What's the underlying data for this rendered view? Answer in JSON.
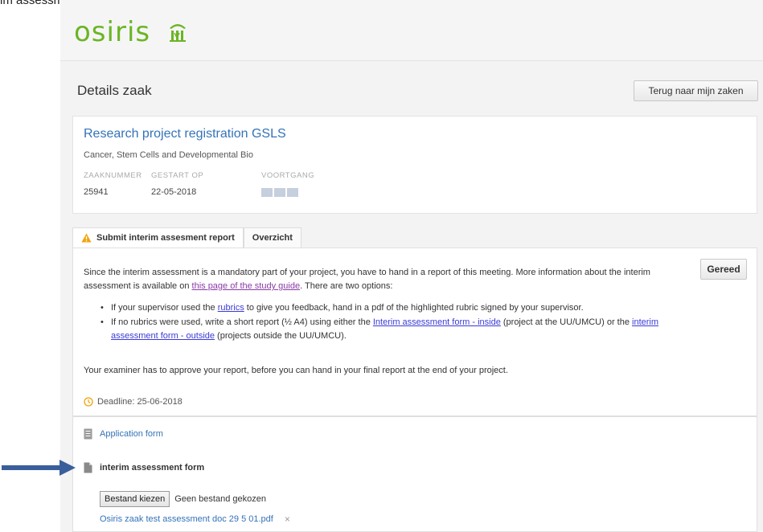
{
  "top_partial_text": "im assessment.",
  "logo": {
    "text": "osiris"
  },
  "page": {
    "title": "Details zaak",
    "back_button": "Terug naar mijn zaken"
  },
  "case": {
    "title": "Research project registration GSLS",
    "subtitle": "Cancer, Stem Cells and Developmental Bio",
    "meta": {
      "number_label": "ZAAKNUMMER",
      "number_value": "25941",
      "started_label": "GESTART OP",
      "started_value": "22-05-2018",
      "progress_label": "VOORTGANG",
      "progress_steps": 3
    }
  },
  "tabs": [
    {
      "label": "Submit interim assesment report",
      "active": true
    },
    {
      "label": "Overzicht",
      "active": false
    }
  ],
  "task": {
    "done_button": "Gereed",
    "intro_part1": "Since the interim assessment is a mandatory part of your project, you have to hand in a report of this meeting. More information about the interim assessment is available on ",
    "intro_link": "this page of the study guide",
    "intro_part2": ". There are two options:",
    "bullet1_part1": "If your supervisor used the ",
    "bullet1_link": "rubrics",
    "bullet1_part2": " to give you feedback, hand in a pdf of the highlighted rubric signed by your supervisor.",
    "bullet2_part1": "If no rubrics were used, write a short report (½ A4) using either the ",
    "bullet2_link1": "Interim assessment form - inside",
    "bullet2_part2": " (project at the UU/UMCU) or the ",
    "bullet2_link2": "interim assessment form - outside",
    "bullet2_part3": " (projects outside the UU/UMCU).",
    "approval_text": "Your examiner has to approve your report, before you can hand in your final report at the end of your project.",
    "deadline": "Deadline: 25-06-2018"
  },
  "files": {
    "application_form": "Application form",
    "interim_label": "interim assessment form",
    "choose_button": "Bestand kiezen",
    "no_file": "Geen bestand gekozen",
    "uploaded_file": "Osiris zaak test assessment doc 29 5 01.pdf",
    "remove": "×"
  },
  "colors": {
    "brand_green": "#6bb524",
    "link_blue": "#3473b8",
    "arrow": "#3a5e9c",
    "warning": "#f0a30a"
  }
}
